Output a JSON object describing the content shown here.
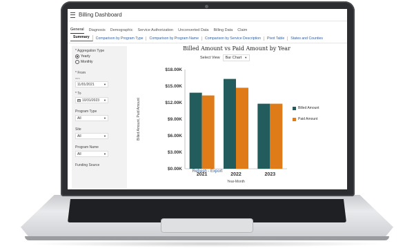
{
  "app": {
    "title": "Billing Dashboard"
  },
  "tabs_primary": [
    {
      "label": "General",
      "active": true
    },
    {
      "label": "Diagnosis",
      "active": false
    },
    {
      "label": "Demographic",
      "active": false
    },
    {
      "label": "Service Authorization",
      "active": false
    },
    {
      "label": "Unconverted Data",
      "active": false
    },
    {
      "label": "Billing Data",
      "active": false
    },
    {
      "label": "Claim",
      "active": false
    }
  ],
  "tabs_secondary": [
    {
      "label": "Summary",
      "active": true
    },
    {
      "label": "Comparison by Program Type",
      "active": false
    },
    {
      "label": "Comparison by Program Name",
      "active": false
    },
    {
      "label": "Comparison by Service Description",
      "active": false
    },
    {
      "label": "Pivot Table",
      "active": false
    },
    {
      "label": "States and Counties",
      "active": false
    }
  ],
  "filters": {
    "aggregation_label": "* Aggregation Type",
    "option_yearly": "Yearly",
    "option_monthly": "Monthly",
    "yearly_selected": true,
    "from_label": "* From",
    "from_hint": "mm",
    "from_value": "11/01/2021",
    "to_label": "* To",
    "to_value": "10/31/2023",
    "program_type_label": "Program Type",
    "program_type_value": "All",
    "site_label": "Site",
    "site_value": "All",
    "program_name_label": "Program Name",
    "program_name_value": "All",
    "funding_source_label": "Funding Source"
  },
  "view": {
    "label": "Select View",
    "selected": "Bar Chart"
  },
  "links": {
    "refresh": "Refresh",
    "separator": "-",
    "export": "Export"
  },
  "colors": {
    "billed": "#235c5c",
    "paid": "#e07b1a"
  },
  "chart_data": {
    "type": "bar",
    "title": "Billed Amount vs Paid Amount by Year",
    "xlabel": "Year-Month",
    "ylabel": "Billed Amount, Paid Amount",
    "categories": [
      "2021",
      "2022",
      "2023"
    ],
    "series": [
      {
        "name": "Billed Amount",
        "values": [
          13800,
          16300,
          11800
        ]
      },
      {
        "name": "Paid Amount",
        "values": [
          13300,
          14700,
          11800
        ]
      }
    ],
    "ylim": [
      0,
      18000
    ],
    "yticks": [
      "$0.00K",
      "$3.00K",
      "$6.00K",
      "$9.00K",
      "$12.00K",
      "$15.00K",
      "$18.00K"
    ],
    "grid": false,
    "legend": "right"
  }
}
